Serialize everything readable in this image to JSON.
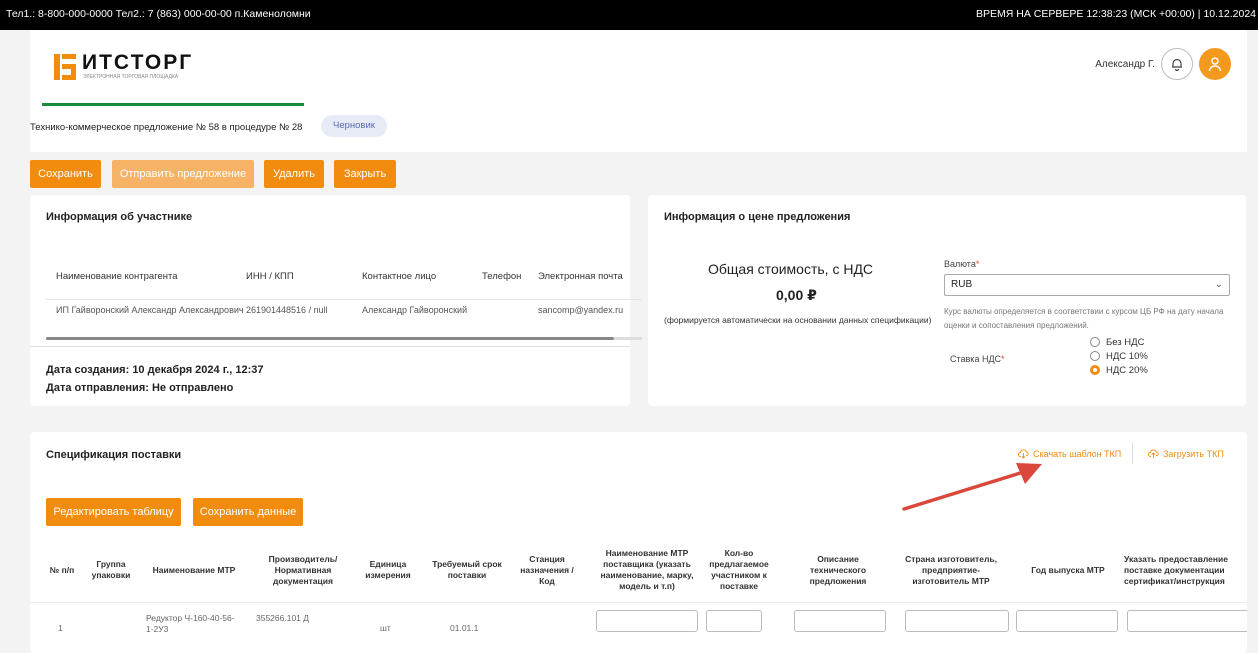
{
  "topbar": {
    "phones": "Тел1.: 8-800-000-0000  Тел2.: 7 (863) 000-00-00 п.Каменоломни",
    "server_time": "ВРЕМЯ НА СЕРВЕРЕ  12:38:23 (МСК +00:00) | 10.12.2024"
  },
  "header": {
    "logo_text": "ИТСТОРГ",
    "logo_sub": "ЭЛЕКТРОННАЯ ТОРГОВАЯ ПЛОЩАДКА",
    "user_name": "Александр Г.",
    "proc_title": "Технико-коммерческое предложение № 58 в процедуре № 28",
    "status": "Черновик"
  },
  "actions": {
    "save": "Сохранить",
    "send": "Отправить предложение",
    "delete": "Удалить",
    "close": "Закрыть"
  },
  "participant": {
    "title": "Информация об участнике",
    "headers": [
      "Наименование контрагента",
      "ИНН / КПП",
      "Контактное лицо",
      "Телефон",
      "Электронная почта"
    ],
    "values": [
      "ИП Гайворонский Александр Александрович",
      "261901448516 / null",
      "Александр Гайворонский",
      "",
      "sancomp@yandex.ru"
    ],
    "created": "Дата создания: 10 декабря 2024 г., 12:37",
    "sent": "Дата отправления: Не отправлено"
  },
  "price": {
    "title": "Информация о цене предложения",
    "total_label": "Общая стоимость, с НДС",
    "total_value": "0,00 ₽",
    "note": "(формируется автоматически на основании данных спецификации)",
    "currency_label": "Валюта",
    "currency_value": "RUB",
    "currency_note": "Курс валюты определяется в соответствии с курсом ЦБ РФ на дату начала оценки и сопоставления предложений.",
    "vat_label": "Ставка НДС",
    "vat_options": [
      "Без НДС",
      "НДС 10%",
      "НДС 20%"
    ],
    "vat_selected": "НДС 20%"
  },
  "spec": {
    "title": "Спецификация поставки",
    "download_link": "Скачать шаблон ТКП",
    "upload_link": "Загрузить ТКП",
    "edit_btn": "Редактировать таблицу",
    "save_btn": "Сохранить данные",
    "columns": [
      "№ п/п",
      "Группа упаковки",
      "Наименование МТР",
      "Производитель/ Нормативная документация",
      "Единица измерения",
      "Требуемый срок поставки",
      "Станция назначения / Код",
      "Наименование МТР поставщика (указать наименование, марку, модель и т.п)",
      "Кол-во предлагаемое участником к поставке",
      "Описание технического предложения",
      "Страна изготовитель, предприятие-изготовитель МТР",
      "Год выпуска МТР",
      "Указать предоставление поставке документации сертификат/инструкция"
    ],
    "row": {
      "num": "1",
      "name": "Редуктор Ч-160-40-56-1-2У3",
      "maker": "355266.101 Д",
      "unit": "шт",
      "date": "01.01.1"
    }
  }
}
